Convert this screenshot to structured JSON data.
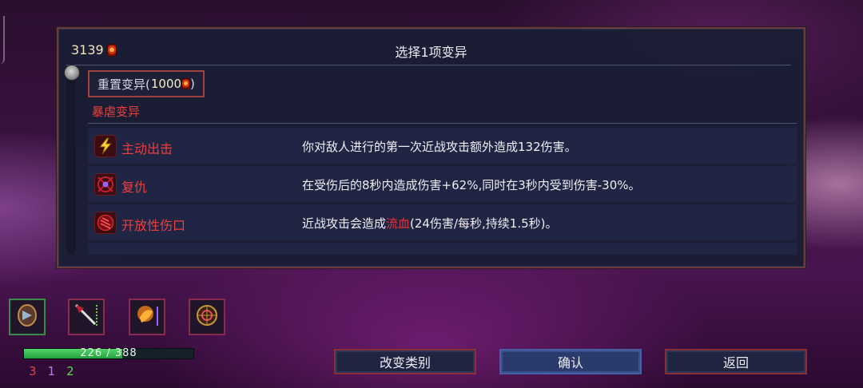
{
  "panel": {
    "gold": "3139",
    "title": "选择1项变异",
    "reset": {
      "label": "重置变异(",
      "cost": "1000",
      "close": ")"
    },
    "category": "暴虐变异",
    "mutations": [
      {
        "name": "主动出击",
        "icon": "lightning-icon",
        "desc_pre": "你对敌人进行的第一次近战攻击额外造成132伤害。",
        "desc_red": "",
        "desc_post": ""
      },
      {
        "name": "复仇",
        "icon": "vengeance-icon",
        "desc_pre": "在受伤后的8秒内造成伤害+62%,同时在3秒内受到伤害-30%。",
        "desc_red": "",
        "desc_post": ""
      },
      {
        "name": "开放性伤口",
        "icon": "open-wound-icon",
        "desc_pre": "近战攻击会造成",
        "desc_red": "流血",
        "desc_post": "(24伤害/每秒,持续1.5秒)。"
      }
    ]
  },
  "player": {
    "hp_text": "226 / 388",
    "hp_fraction": 0.5825,
    "stats": {
      "brutality": "3",
      "tactics": "1",
      "survival": "2"
    },
    "slots": [
      "shield-item-icon",
      "bow-item-icon",
      "skill-item-icon",
      "amulet-item-icon"
    ]
  },
  "buttons": {
    "change_category": "改变类别",
    "confirm": "确认",
    "back": "返回"
  },
  "colors": {
    "accent_red": "#ef3d3d",
    "panel_bg": "#1a1e34",
    "hp_green": "#22a23e"
  }
}
